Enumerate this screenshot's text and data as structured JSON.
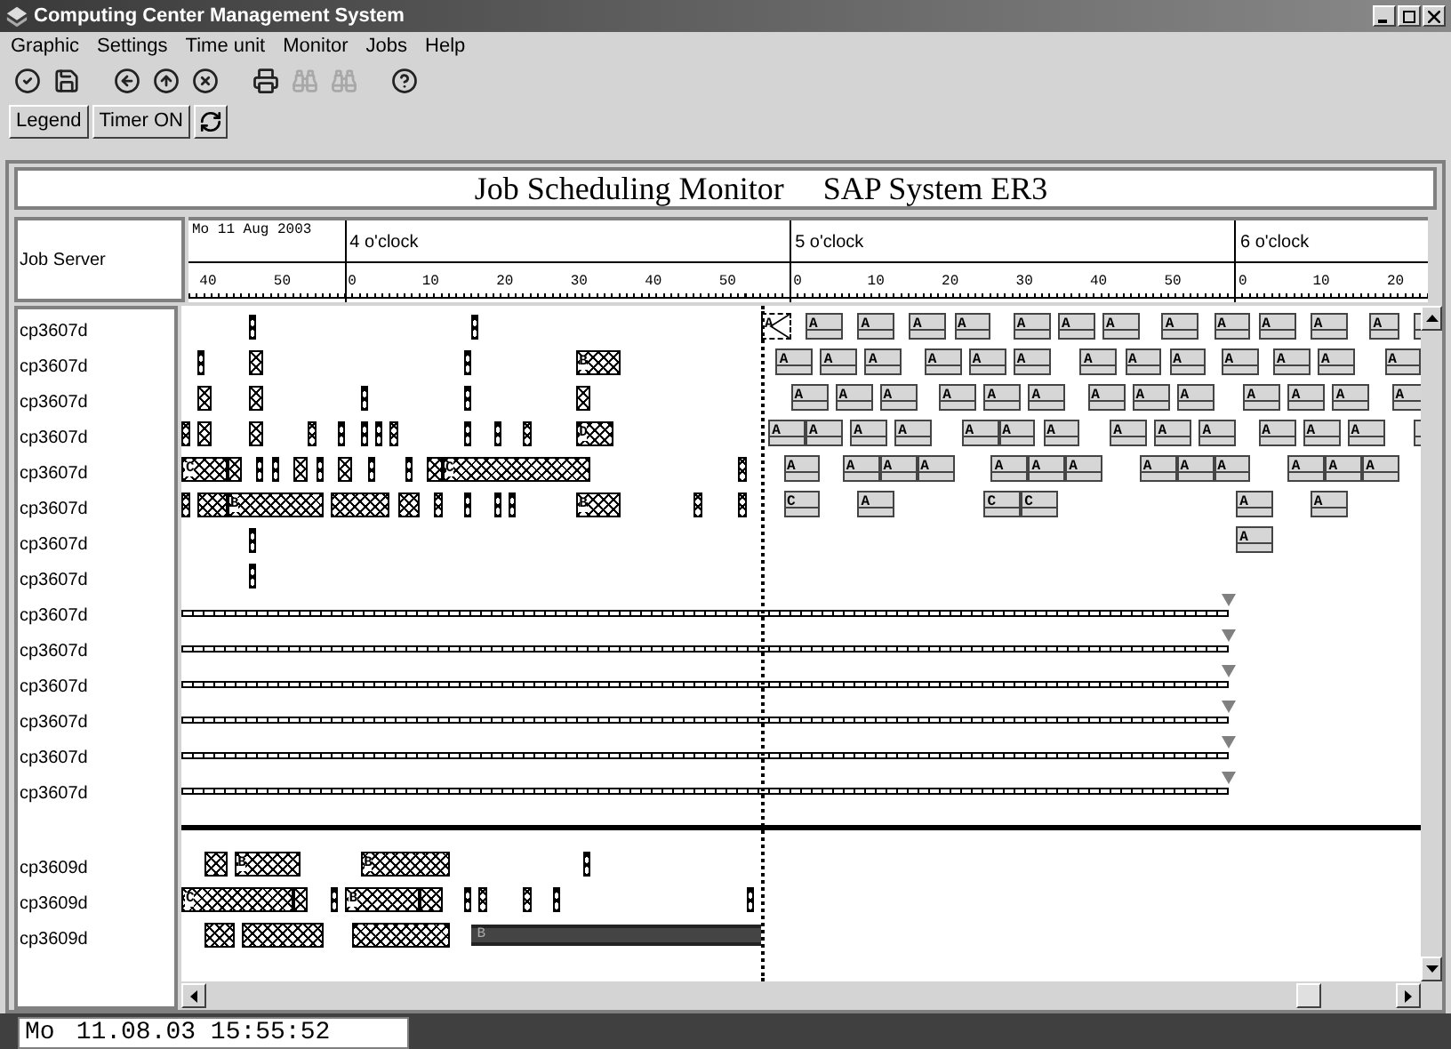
{
  "window": {
    "title": "Computing Center Management System"
  },
  "menu": [
    "Graphic",
    "Settings",
    "Time unit",
    "Monitor",
    "Jobs",
    "Help"
  ],
  "toolbar": [
    {
      "kind": "check",
      "disabled": false
    },
    {
      "kind": "save",
      "disabled": false
    },
    {
      "kind": "gap"
    },
    {
      "kind": "back",
      "disabled": false
    },
    {
      "kind": "up",
      "disabled": false
    },
    {
      "kind": "cancel",
      "disabled": false
    },
    {
      "kind": "gap"
    },
    {
      "kind": "print",
      "disabled": false
    },
    {
      "kind": "find",
      "disabled": true
    },
    {
      "kind": "find-next",
      "disabled": true
    },
    {
      "kind": "gap"
    },
    {
      "kind": "help",
      "disabled": false
    }
  ],
  "buttons": [
    {
      "kind": "text",
      "label": "Legend"
    },
    {
      "kind": "text",
      "label": "Timer ON"
    },
    {
      "kind": "refresh"
    }
  ],
  "banner": {
    "title": "Job Scheduling Monitor",
    "system": "SAP System ER3"
  },
  "column_header": "Job Server",
  "timeline": {
    "date": "Mo 11 Aug 2003",
    "segments": [
      {
        "ticks": [
          "40",
          "50"
        ]
      },
      {
        "label": "4 o'clock",
        "ticks": [
          "0",
          "10",
          "20",
          "30",
          "40",
          "50"
        ]
      },
      {
        "label": "5 o'clock",
        "ticks": [
          "0",
          "10",
          "20",
          "30",
          "40",
          "50"
        ]
      },
      {
        "label": "6 o'clock",
        "ticks": [
          "0",
          "10",
          "20"
        ]
      }
    ]
  },
  "groups": [
    {
      "rows": [
        {
          "server": "cp3607d",
          "kind": "jobs",
          "jobs": [
            {
              "kind": "done"
            },
            {
              "kind": "done"
            },
            {
              "kind": "cancelled",
              "label": "A"
            },
            {
              "kind": "scheduled",
              "label": "A"
            },
            {
              "kind": "scheduled",
              "label": "A"
            },
            {
              "kind": "scheduled",
              "label": "A"
            },
            {
              "kind": "scheduled",
              "label": "A"
            },
            {
              "kind": "scheduled",
              "label": "A"
            },
            {
              "kind": "scheduled",
              "label": "A"
            },
            {
              "kind": "scheduled",
              "label": "A"
            },
            {
              "kind": "scheduled",
              "label": "A"
            },
            {
              "kind": "scheduled",
              "label": "A"
            },
            {
              "kind": "scheduled",
              "label": "A"
            },
            {
              "kind": "scheduled",
              "label": "A"
            },
            {
              "kind": "scheduled",
              "label": "A"
            },
            {
              "kind": "scheduled"
            }
          ]
        },
        {
          "server": "cp3607d",
          "kind": "jobs",
          "jobs": [
            {
              "kind": "done"
            },
            {
              "kind": "done"
            },
            {
              "kind": "done"
            },
            {
              "kind": "done",
              "label": "B"
            },
            {
              "kind": "scheduled",
              "label": "A"
            },
            {
              "kind": "scheduled",
              "label": "A"
            },
            {
              "kind": "scheduled",
              "label": "A"
            },
            {
              "kind": "scheduled",
              "label": "A"
            },
            {
              "kind": "scheduled",
              "label": "A"
            },
            {
              "kind": "scheduled",
              "label": "A"
            },
            {
              "kind": "scheduled",
              "label": "A"
            },
            {
              "kind": "scheduled",
              "label": "A"
            },
            {
              "kind": "scheduled",
              "label": "A"
            },
            {
              "kind": "scheduled",
              "label": "A"
            },
            {
              "kind": "scheduled",
              "label": "A"
            },
            {
              "kind": "scheduled",
              "label": "A"
            },
            {
              "kind": "scheduled",
              "label": "A"
            }
          ]
        },
        {
          "server": "cp3607d",
          "kind": "jobs",
          "jobs": [
            {
              "kind": "done"
            },
            {
              "kind": "done"
            },
            {
              "kind": "done"
            },
            {
              "kind": "done"
            },
            {
              "kind": "done"
            },
            {
              "kind": "scheduled",
              "label": "A"
            },
            {
              "kind": "scheduled",
              "label": "A"
            },
            {
              "kind": "scheduled",
              "label": "A"
            },
            {
              "kind": "scheduled",
              "label": "A"
            },
            {
              "kind": "scheduled",
              "label": "A"
            },
            {
              "kind": "scheduled",
              "label": "A"
            },
            {
              "kind": "scheduled",
              "label": "A"
            },
            {
              "kind": "scheduled",
              "label": "A"
            },
            {
              "kind": "scheduled",
              "label": "A"
            },
            {
              "kind": "scheduled",
              "label": "A"
            },
            {
              "kind": "scheduled",
              "label": "A"
            },
            {
              "kind": "scheduled",
              "label": "A"
            },
            {
              "kind": "scheduled",
              "label": "A"
            }
          ]
        },
        {
          "server": "cp3607d",
          "kind": "jobs",
          "jobs": [
            {
              "kind": "done"
            },
            {
              "kind": "done"
            },
            {
              "kind": "done"
            },
            {
              "kind": "done"
            },
            {
              "kind": "done"
            },
            {
              "kind": "done"
            },
            {
              "kind": "done"
            },
            {
              "kind": "done"
            },
            {
              "kind": "done"
            },
            {
              "kind": "done"
            },
            {
              "kind": "done"
            },
            {
              "kind": "done",
              "label": "D"
            },
            {
              "kind": "scheduled",
              "label": "A"
            },
            {
              "kind": "scheduled",
              "label": "A"
            },
            {
              "kind": "scheduled",
              "label": "A"
            },
            {
              "kind": "scheduled",
              "label": "A"
            },
            {
              "kind": "scheduled",
              "label": "A"
            },
            {
              "kind": "scheduled",
              "label": "A"
            },
            {
              "kind": "scheduled",
              "label": "A"
            },
            {
              "kind": "scheduled",
              "label": "A"
            },
            {
              "kind": "scheduled",
              "label": "A"
            },
            {
              "kind": "scheduled",
              "label": "A"
            },
            {
              "kind": "scheduled",
              "label": "A"
            },
            {
              "kind": "scheduled",
              "label": "A"
            },
            {
              "kind": "scheduled",
              "label": "A"
            },
            {
              "kind": "scheduled"
            }
          ]
        },
        {
          "server": "cp3607d",
          "kind": "jobs",
          "jobs": [
            {
              "kind": "done",
              "label": "C"
            },
            {
              "kind": "done"
            },
            {
              "kind": "done"
            },
            {
              "kind": "done"
            },
            {
              "kind": "done"
            },
            {
              "kind": "done"
            },
            {
              "kind": "done"
            },
            {
              "kind": "done"
            },
            {
              "kind": "done"
            },
            {
              "kind": "done"
            },
            {
              "kind": "done",
              "label": "C"
            },
            {
              "kind": "done"
            },
            {
              "kind": "scheduled",
              "label": "A"
            },
            {
              "kind": "scheduled",
              "label": "A"
            },
            {
              "kind": "scheduled",
              "label": "A"
            },
            {
              "kind": "scheduled",
              "label": "A"
            },
            {
              "kind": "scheduled",
              "label": "A"
            },
            {
              "kind": "scheduled",
              "label": "A"
            },
            {
              "kind": "scheduled",
              "label": "A"
            },
            {
              "kind": "scheduled",
              "label": "A"
            },
            {
              "kind": "scheduled",
              "label": "A"
            },
            {
              "kind": "scheduled",
              "label": "A"
            },
            {
              "kind": "scheduled",
              "label": "A"
            },
            {
              "kind": "scheduled",
              "label": "A"
            },
            {
              "kind": "scheduled",
              "label": "A"
            }
          ]
        },
        {
          "server": "cp3607d",
          "kind": "jobs",
          "jobs": [
            {
              "kind": "done"
            },
            {
              "kind": "done"
            },
            {
              "kind": "done",
              "label": "B"
            },
            {
              "kind": "done"
            },
            {
              "kind": "done"
            },
            {
              "kind": "done"
            },
            {
              "kind": "done"
            },
            {
              "kind": "done"
            },
            {
              "kind": "done"
            },
            {
              "kind": "done",
              "label": "B"
            },
            {
              "kind": "done"
            },
            {
              "kind": "done"
            },
            {
              "kind": "scheduled",
              "label": "C"
            },
            {
              "kind": "scheduled",
              "label": "A"
            },
            {
              "kind": "scheduled",
              "label": "C"
            },
            {
              "kind": "scheduled",
              "label": "C"
            },
            {
              "kind": "scheduled",
              "label": "A"
            },
            {
              "kind": "scheduled",
              "label": "A"
            }
          ]
        },
        {
          "server": "cp3607d",
          "kind": "jobs",
          "jobs": [
            {
              "kind": "done"
            },
            {
              "kind": "scheduled",
              "label": "A"
            }
          ]
        },
        {
          "server": "cp3607d",
          "kind": "jobs",
          "jobs": [
            {
              "kind": "done"
            }
          ]
        },
        {
          "server": "cp3607d",
          "kind": "pending"
        },
        {
          "server": "cp3607d",
          "kind": "pending"
        },
        {
          "server": "cp3607d",
          "kind": "pending"
        },
        {
          "server": "cp3607d",
          "kind": "pending"
        },
        {
          "server": "cp3607d",
          "kind": "pending"
        },
        {
          "server": "cp3607d",
          "kind": "pending"
        }
      ]
    },
    {
      "rows": [
        {
          "server": "cp3609d",
          "kind": "jobs",
          "jobs": [
            {
              "kind": "done"
            },
            {
              "kind": "done",
              "label": "B"
            },
            {
              "kind": "done",
              "label": "B"
            },
            {
              "kind": "done"
            }
          ]
        },
        {
          "server": "cp3609d",
          "kind": "jobs",
          "jobs": [
            {
              "kind": "done",
              "label": "C"
            },
            {
              "kind": "done"
            },
            {
              "kind": "done"
            },
            {
              "kind": "done",
              "label": "B"
            },
            {
              "kind": "done"
            },
            {
              "kind": "done"
            },
            {
              "kind": "done"
            },
            {
              "kind": "done"
            },
            {
              "kind": "done"
            },
            {
              "kind": "done"
            }
          ]
        },
        {
          "server": "cp3609d",
          "kind": "jobs",
          "jobs": [
            {
              "kind": "done"
            },
            {
              "kind": "done"
            },
            {
              "kind": "done"
            },
            {
              "kind": "running",
              "label": "B"
            }
          ]
        }
      ]
    }
  ],
  "status_bar": {
    "day": "Mo",
    "datetime": "11.08.03 15:55:52"
  }
}
